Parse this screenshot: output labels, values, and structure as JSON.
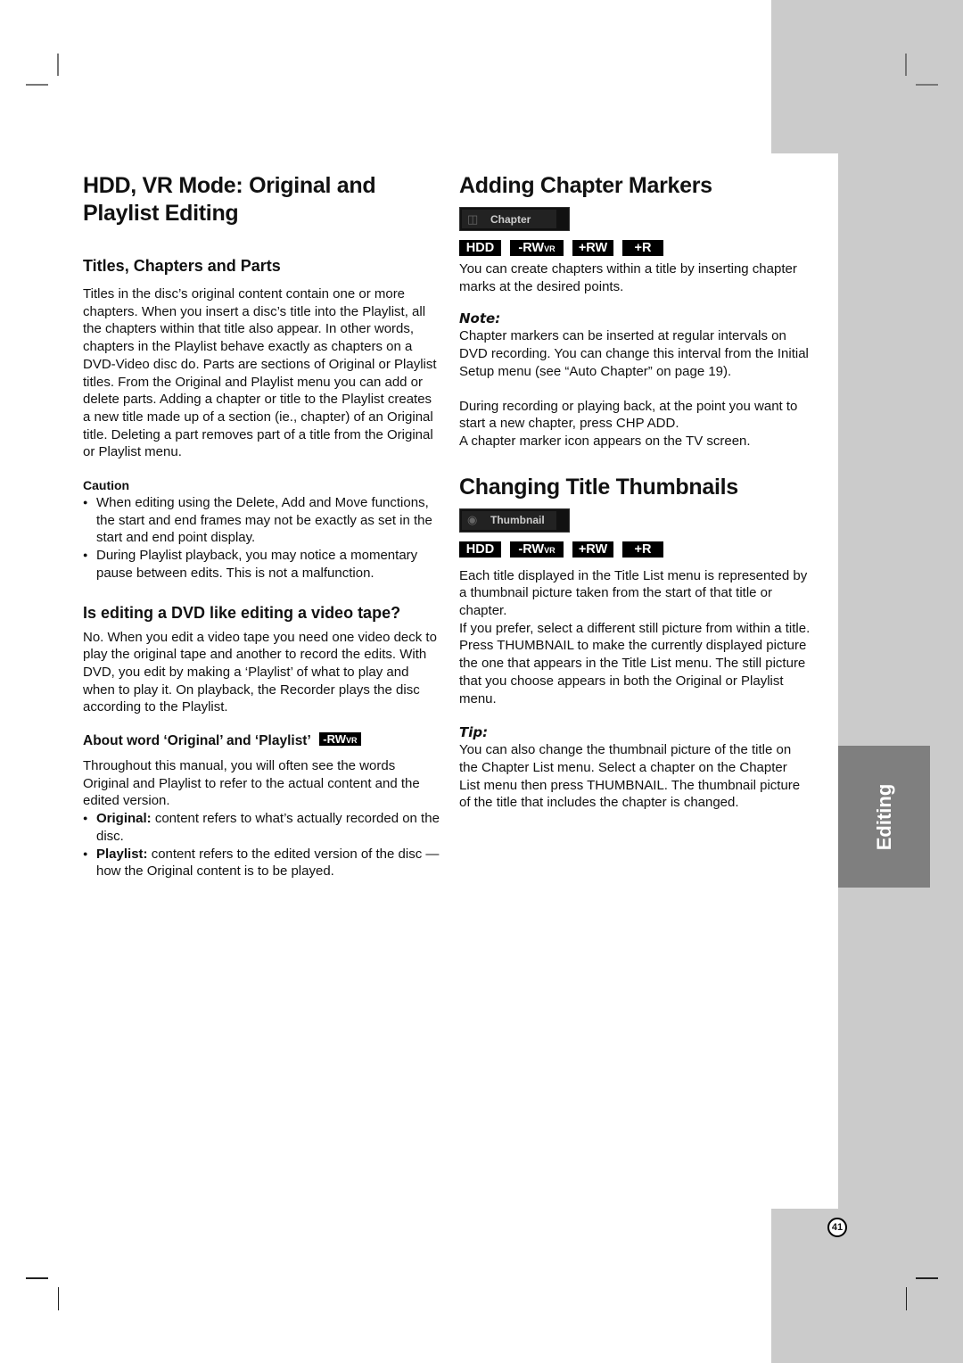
{
  "side_tab": {
    "label": "Editing"
  },
  "page_number": "41",
  "left": {
    "title": "HDD, VR Mode: Original and Playlist Editing",
    "section1": {
      "heading": "Titles, Chapters and Parts",
      "body": "Titles in the disc’s original content contain one or more chapters. When you insert a disc’s title into the Playlist, all the chapters within that title also appear. In other words, chapters in the Playlist behave exactly as chapters on a DVD-Video disc do. Parts are sections of Original or Playlist titles. From the Original and Playlist menu you can add or delete parts. Adding a chapter or title to the Playlist creates a new title made up of a section (ie., chapter) of an Original title. Deleting a part removes part of a title from the Original or Playlist menu."
    },
    "caution": {
      "label": "Caution",
      "items": [
        "When editing using the Delete, Add and Move functions, the start and end frames may not be exactly as set in the start and end point display.",
        "During Playlist playback, you may notice a momentary pause between edits. This is not a malfunction."
      ]
    },
    "section2": {
      "heading": "Is editing a DVD like editing a video tape?",
      "body": "No. When you edit a video tape you need one video deck to play the original tape and another to record the edits. With DVD, you edit by making a ‘Playlist’ of what to play and when to play it. On playback, the Recorder plays the disc according to the Playlist."
    },
    "section3": {
      "heading": "About word ‘Original’ and ‘Playlist’",
      "badge_main": "-RW",
      "badge_sub": "VR",
      "body": "Throughout this manual, you will often see the words Original and Playlist to refer to the actual content and the edited version.",
      "items": [
        {
          "term": "Original:",
          "text": " content refers to what’s actually recorded on the disc."
        },
        {
          "term": "Playlist:",
          "text": " content refers to the edited version of the disc — how the Original content is to be played."
        }
      ]
    }
  },
  "right": {
    "chapter": {
      "title": "Adding Chapter Markers",
      "menu_label": "Chapter",
      "discs": [
        "HDD",
        "-RW",
        "VR",
        "+RW",
        "+R"
      ],
      "body": "You can create chapters within a title by inserting chapter marks at the desired points.",
      "note_label": "Note:",
      "note_body": "Chapter markers can be inserted at regular intervals on DVD recording. You can change this interval from the Initial Setup menu (see “Auto Chapter” on page 19).",
      "body2_line1": "During recording or playing back, at the point you want to start a new chapter, press CHP ADD.",
      "body2_line2": "A chapter marker icon appears on the TV screen."
    },
    "thumbnail": {
      "title": "Changing Title Thumbnails",
      "menu_label": "Thumbnail",
      "discs": [
        "HDD",
        "-RW",
        "VR",
        "+RW",
        "+R"
      ],
      "p1": "Each title displayed in the Title List menu is represented by a thumbnail picture taken from the start of that title or chapter.",
      "p2": "If you prefer, select a different still picture from within a title.",
      "p3": "Press THUMBNAIL to make the currently displayed picture the one that appears in the Title List menu. The still picture that you choose appears in both the Original or Playlist menu.",
      "tip_label": "Tip:",
      "tip_body": "You can also change the thumbnail picture of the title on the Chapter List menu. Select a chapter on the Chapter List menu then press THUMBNAIL. The thumbnail picture of the title that includes the chapter is changed."
    }
  }
}
